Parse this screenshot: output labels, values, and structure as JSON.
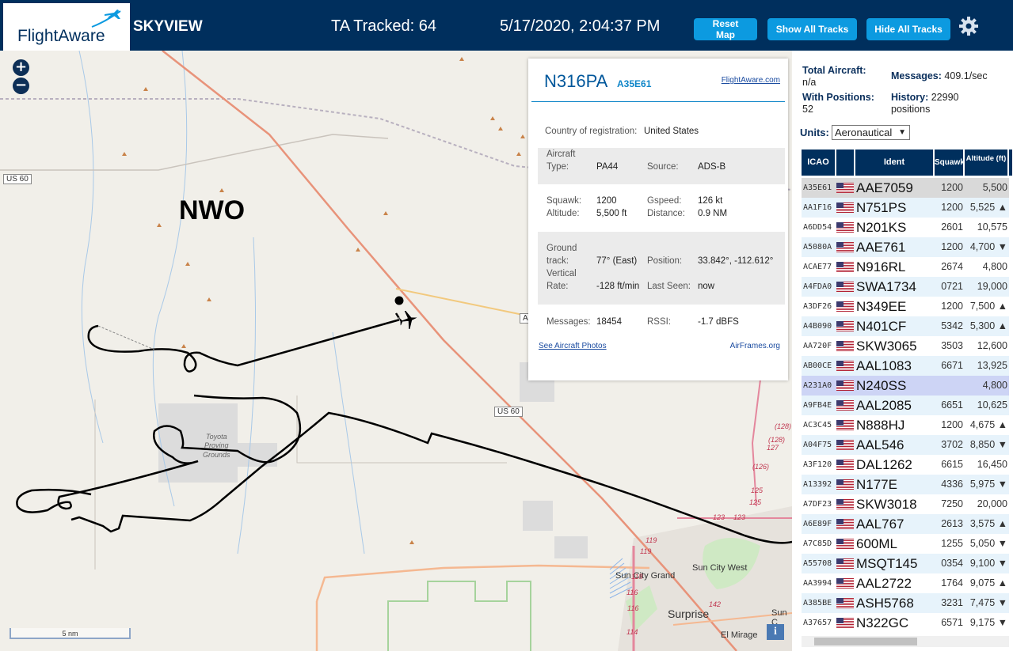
{
  "header": {
    "logo_text": "FlightAware",
    "app_title": "SKYVIEW",
    "tracked": "TA Tracked: 64",
    "datetime": "5/17/2020, 2:04:37 PM",
    "reset_map": "Reset Map",
    "show_tracks": "Show All Tracks",
    "hide_tracks": "Hide All Tracks"
  },
  "map": {
    "zoom_in": "+",
    "zoom_out": "−",
    "region_label": "NWO",
    "shields": [
      "US 60",
      "US 60",
      "A"
    ],
    "labels": {
      "toyota_1": "Toyota",
      "toyota_2": "Proving",
      "toyota_3": "Grounds",
      "sun_city_grand": "Sun City Grand",
      "sun_city_west": "Sun City West",
      "surprise": "Surprise",
      "el_mirage": "El Mirage",
      "sun_c": "Sun C",
      "r128a": "(128)",
      "r128b": "(128)",
      "r127": "127",
      "r126": "(126)",
      "r125a": "125",
      "r125b": "125",
      "r123a": "123",
      "r123b": "123",
      "r119a": "119",
      "r119b": "119",
      "r118": "118",
      "r116a": "116",
      "r116b": "116",
      "r114": "114",
      "r142": "142"
    },
    "scale": "5 nm",
    "info_icon": "i"
  },
  "popup": {
    "ident": "N316PA",
    "icao": "A35E61",
    "fa_link": "FlightAware.com",
    "country_label": "Country of registration:",
    "country_value": "United States",
    "aircraft_type_label_1": "Aircraft",
    "aircraft_type_label_2": "Type:",
    "aircraft_type_value": "PA44",
    "source_label": "Source:",
    "source_value": "ADS-B",
    "squawk_label": "Squawk:",
    "squawk_value": "1200",
    "altitude_label": "Altitude:",
    "altitude_value": "5,500 ft",
    "gspeed_label": "Gspeed:",
    "gspeed_value": "126 kt",
    "distance_label": "Distance:",
    "distance_value": "0.9 NM",
    "ground_label_1": "Ground",
    "ground_label_2": "track:",
    "ground_value": "77° (East)",
    "position_label": "Position:",
    "position_value": "33.842°, -112.612°",
    "vrate_label_1": "Vertical",
    "vrate_label_2": "Rate:",
    "vrate_value": "-128 ft/min",
    "lastseen_label": "Last Seen:",
    "lastseen_value": "now",
    "messages_label": "Messages:",
    "messages_value": "18454",
    "rssi_label": "RSSI:",
    "rssi_value": "-1.7 dBFS",
    "photos_link": "See Aircraft Photos",
    "airframes_link": "AirFrames.org"
  },
  "sidebar": {
    "total_label": "Total Aircraft:",
    "total_value": "n/a",
    "messages_label": "Messages:",
    "messages_value": "409.1/sec",
    "withpos_label": "With Positions:",
    "withpos_value": "52",
    "history_label": "History:",
    "history_value": "22990",
    "history_unit": "positions",
    "units_label": "Units:",
    "units_value": "Aeronautical",
    "headers": [
      "ICAO",
      "Ident",
      "Squawk",
      "Altitude (ft)"
    ],
    "rows": [
      {
        "icao": "A35E61",
        "ident": "AAE7059",
        "squawk": "1200",
        "alt": "5,500"
      },
      {
        "icao": "AA1F16",
        "ident": "N751PS",
        "squawk": "1200",
        "alt": "5,525 ▲"
      },
      {
        "icao": "A6DD54",
        "ident": "N201KS",
        "squawk": "2601",
        "alt": "10,575"
      },
      {
        "icao": "A5080A",
        "ident": "AAE761",
        "squawk": "1200",
        "alt": "4,700 ▼"
      },
      {
        "icao": "ACAE77",
        "ident": "N916RL",
        "squawk": "2674",
        "alt": "4,800"
      },
      {
        "icao": "A4FDA0",
        "ident": "SWA1734",
        "squawk": "0721",
        "alt": "19,000 ▲"
      },
      {
        "icao": "A3DF26",
        "ident": "N349EE",
        "squawk": "1200",
        "alt": "7,500 ▲"
      },
      {
        "icao": "A4B090",
        "ident": "N401CF",
        "squawk": "5342",
        "alt": "5,300 ▲"
      },
      {
        "icao": "AA720F",
        "ident": "SKW3065",
        "squawk": "3503",
        "alt": "12,600 ▼"
      },
      {
        "icao": "AB00CE",
        "ident": "AAL1083",
        "squawk": "6671",
        "alt": "13,925 ▼"
      },
      {
        "icao": "A231A0",
        "ident": "N240SS",
        "squawk": "",
        "alt": "4,800"
      },
      {
        "icao": "A9FB4E",
        "ident": "AAL2085",
        "squawk": "6651",
        "alt": "10,625 ▼"
      },
      {
        "icao": "AC3C45",
        "ident": "N888HJ",
        "squawk": "1200",
        "alt": "4,675 ▲"
      },
      {
        "icao": "A04F75",
        "ident": "AAL546",
        "squawk": "3702",
        "alt": "8,850 ▼"
      },
      {
        "icao": "A3F120",
        "ident": "DAL1262",
        "squawk": "6615",
        "alt": "16,450 ▼"
      },
      {
        "icao": "A13392",
        "ident": "N177E",
        "squawk": "4336",
        "alt": "5,975 ▼"
      },
      {
        "icao": "A7DF23",
        "ident": "SKW3018",
        "squawk": "7250",
        "alt": "20,000 ▼"
      },
      {
        "icao": "A6E89F",
        "ident": "AAL767",
        "squawk": "2613",
        "alt": "3,575 ▲"
      },
      {
        "icao": "A7C85D",
        "ident": "600ML",
        "squawk": "1255",
        "alt": "5,050 ▼"
      },
      {
        "icao": "A55708",
        "ident": "MSQT145",
        "squawk": "0354",
        "alt": "9,100 ▼"
      },
      {
        "icao": "AA3994",
        "ident": "AAL2722",
        "squawk": "1764",
        "alt": "9,075 ▲"
      },
      {
        "icao": "A385BE",
        "ident": "ASH5768",
        "squawk": "3231",
        "alt": "7,475 ▼"
      },
      {
        "icao": "A37657",
        "ident": "N322GC",
        "squawk": "6571",
        "alt": "9,175 ▼"
      }
    ]
  },
  "colors": {
    "header_bg": "#002f5d",
    "button": "#0c9ae0",
    "track": "#000000",
    "highway": "#e8937a",
    "selected_row": "#d9d9d9",
    "highlight_row": "#cdd4f5",
    "row_alt": "#e7f3fb"
  }
}
